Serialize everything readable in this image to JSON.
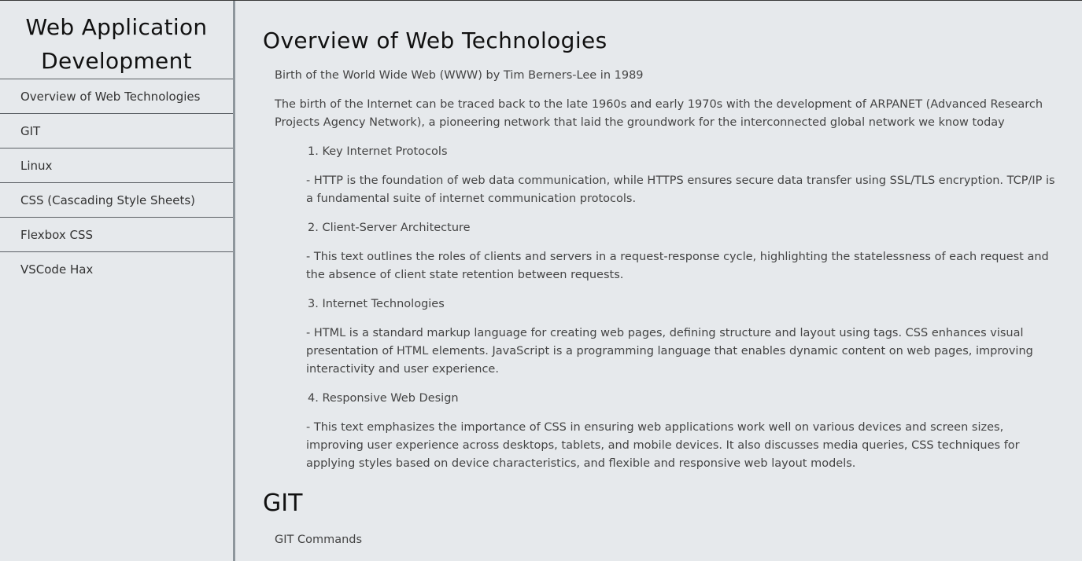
{
  "sidebar": {
    "title": "Web Application Development",
    "items": [
      {
        "label": "Overview of Web Technologies"
      },
      {
        "label": "GIT"
      },
      {
        "label": "Linux"
      },
      {
        "label": "CSS (Cascading Style Sheets)"
      },
      {
        "label": "Flexbox CSS"
      },
      {
        "label": "VSCode Hax"
      }
    ]
  },
  "main": {
    "overview": {
      "title": "Overview of Web Technologies",
      "lead": "Birth of the World Wide Web (WWW) by Tim Berners-Lee in 1989",
      "intro": "The birth of the Internet can be traced back to the late 1960s and early 1970s with the development of ARPANET (Advanced Research Projects Agency Network), a pioneering network that laid the groundwork for the interconnected global network we know today",
      "topics": [
        {
          "heading": "1. Key Internet Protocols",
          "desc": "- HTTP is the foundation of web data communication, while HTTPS ensures secure data transfer using SSL/TLS encryption. TCP/IP is a fundamental suite of internet communication protocols."
        },
        {
          "heading": "2. Client-Server Architecture",
          "desc": "- This text outlines the roles of clients and servers in a request-response cycle, highlighting the statelessness of each request and the absence of client state retention between requests."
        },
        {
          "heading": "3. Internet Technologies",
          "desc": "- HTML is a standard markup language for creating web pages, defining structure and layout using tags. CSS enhances visual presentation of HTML elements. JavaScript is a programming language that enables dynamic content on web pages, improving interactivity and user experience."
        },
        {
          "heading": "4. Responsive Web Design",
          "desc": "- This text emphasizes the importance of CSS in ensuring web applications work well on various devices and screen sizes, improving user experience across desktops, tablets, and mobile devices. It also discusses media queries, CSS techniques for applying styles based on device characteristics, and flexible and responsive web layout models."
        }
      ]
    },
    "git": {
      "title": "GIT",
      "lead": "GIT Commands"
    }
  },
  "colors": {
    "background": "#e6e9ec",
    "sidebar_divider": "#8e969c",
    "heading_text": "#111111",
    "body_text": "#444444"
  }
}
